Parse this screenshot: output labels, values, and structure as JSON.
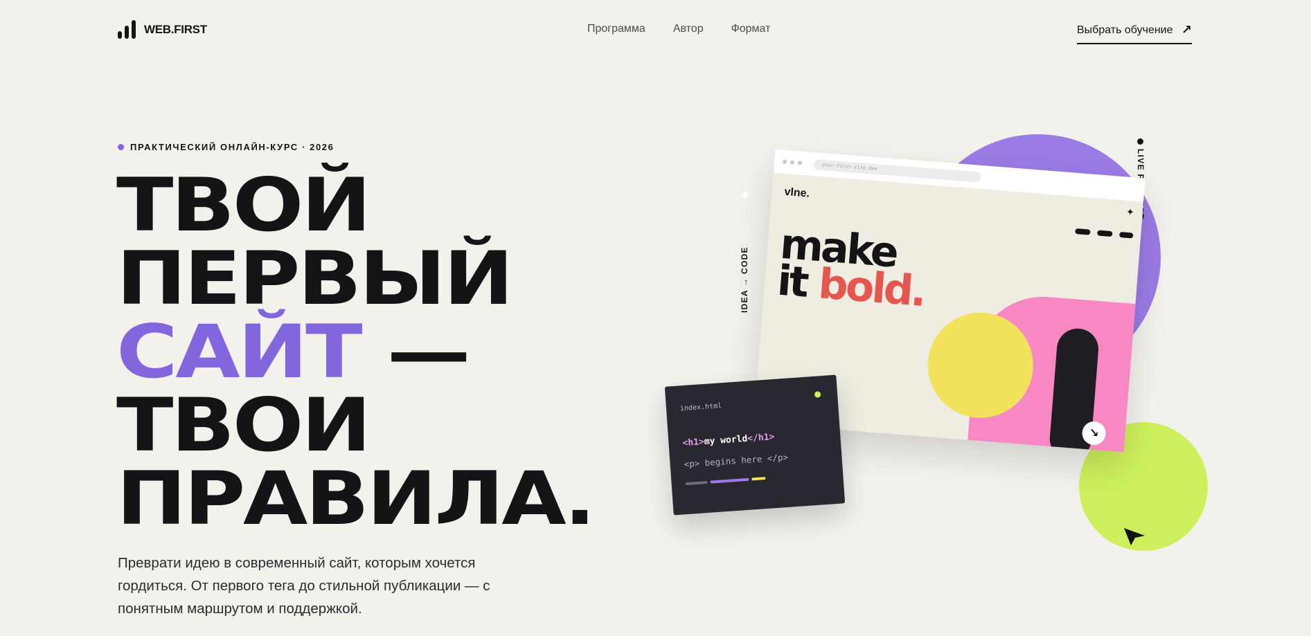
{
  "header": {
    "logo_text": "WEB.FIRST",
    "nav": [
      "Программа",
      "Автор",
      "Формат"
    ],
    "cta_label": "Выбрать обучение",
    "cta_arrow": "↗"
  },
  "hero": {
    "eyebrow": "ПРАКТИЧЕСКИЙ ОНЛАЙН-КУРС · 2026",
    "headline": {
      "line1": "ТВОЙ",
      "line2": "ПЕРВЫЙ",
      "line3_accent": "САЙТ",
      "line3_rest": " —",
      "line4": "ТВОИ",
      "line5": "ПРАВИЛА."
    },
    "lead": "Преврати идею в современный сайт, которым хочется гордиться. От первого тега до стильной публикации — с понятным маршрутом и поддержкой."
  },
  "illustration": {
    "label_vertical_left": "IDEA → CODE",
    "label_vertical_right": "LIVE PROJECT",
    "browser": {
      "url": "your-first-site.dev",
      "site_logo": "vlne.",
      "headline_line1": "make",
      "headline_line2_word": "it",
      "headline_line2_accent": "bold.",
      "corner_button_icon": "↘"
    },
    "code_card": {
      "filename": "index.html",
      "line1_open": "<h1>",
      "line1_text": "my world",
      "line1_close": "</h1>",
      "line2": "<p> begins here </p>"
    }
  },
  "colors": {
    "background": "#f3f1ec",
    "text": "#141416",
    "accent_purple": "#8266dd",
    "circle_purple": "#9b7be6",
    "lime": "#cdf05c",
    "pink": "#f788c4",
    "yellow": "#f2e25c",
    "red": "#e5574e",
    "code_bg": "#292830"
  },
  "icons": {
    "logo": "bars-logo-icon",
    "cta": "arrow-up-right-icon",
    "cursor": "cursor-arrow-icon",
    "sparkle": "sparkle-icon",
    "star": "star-icon"
  }
}
